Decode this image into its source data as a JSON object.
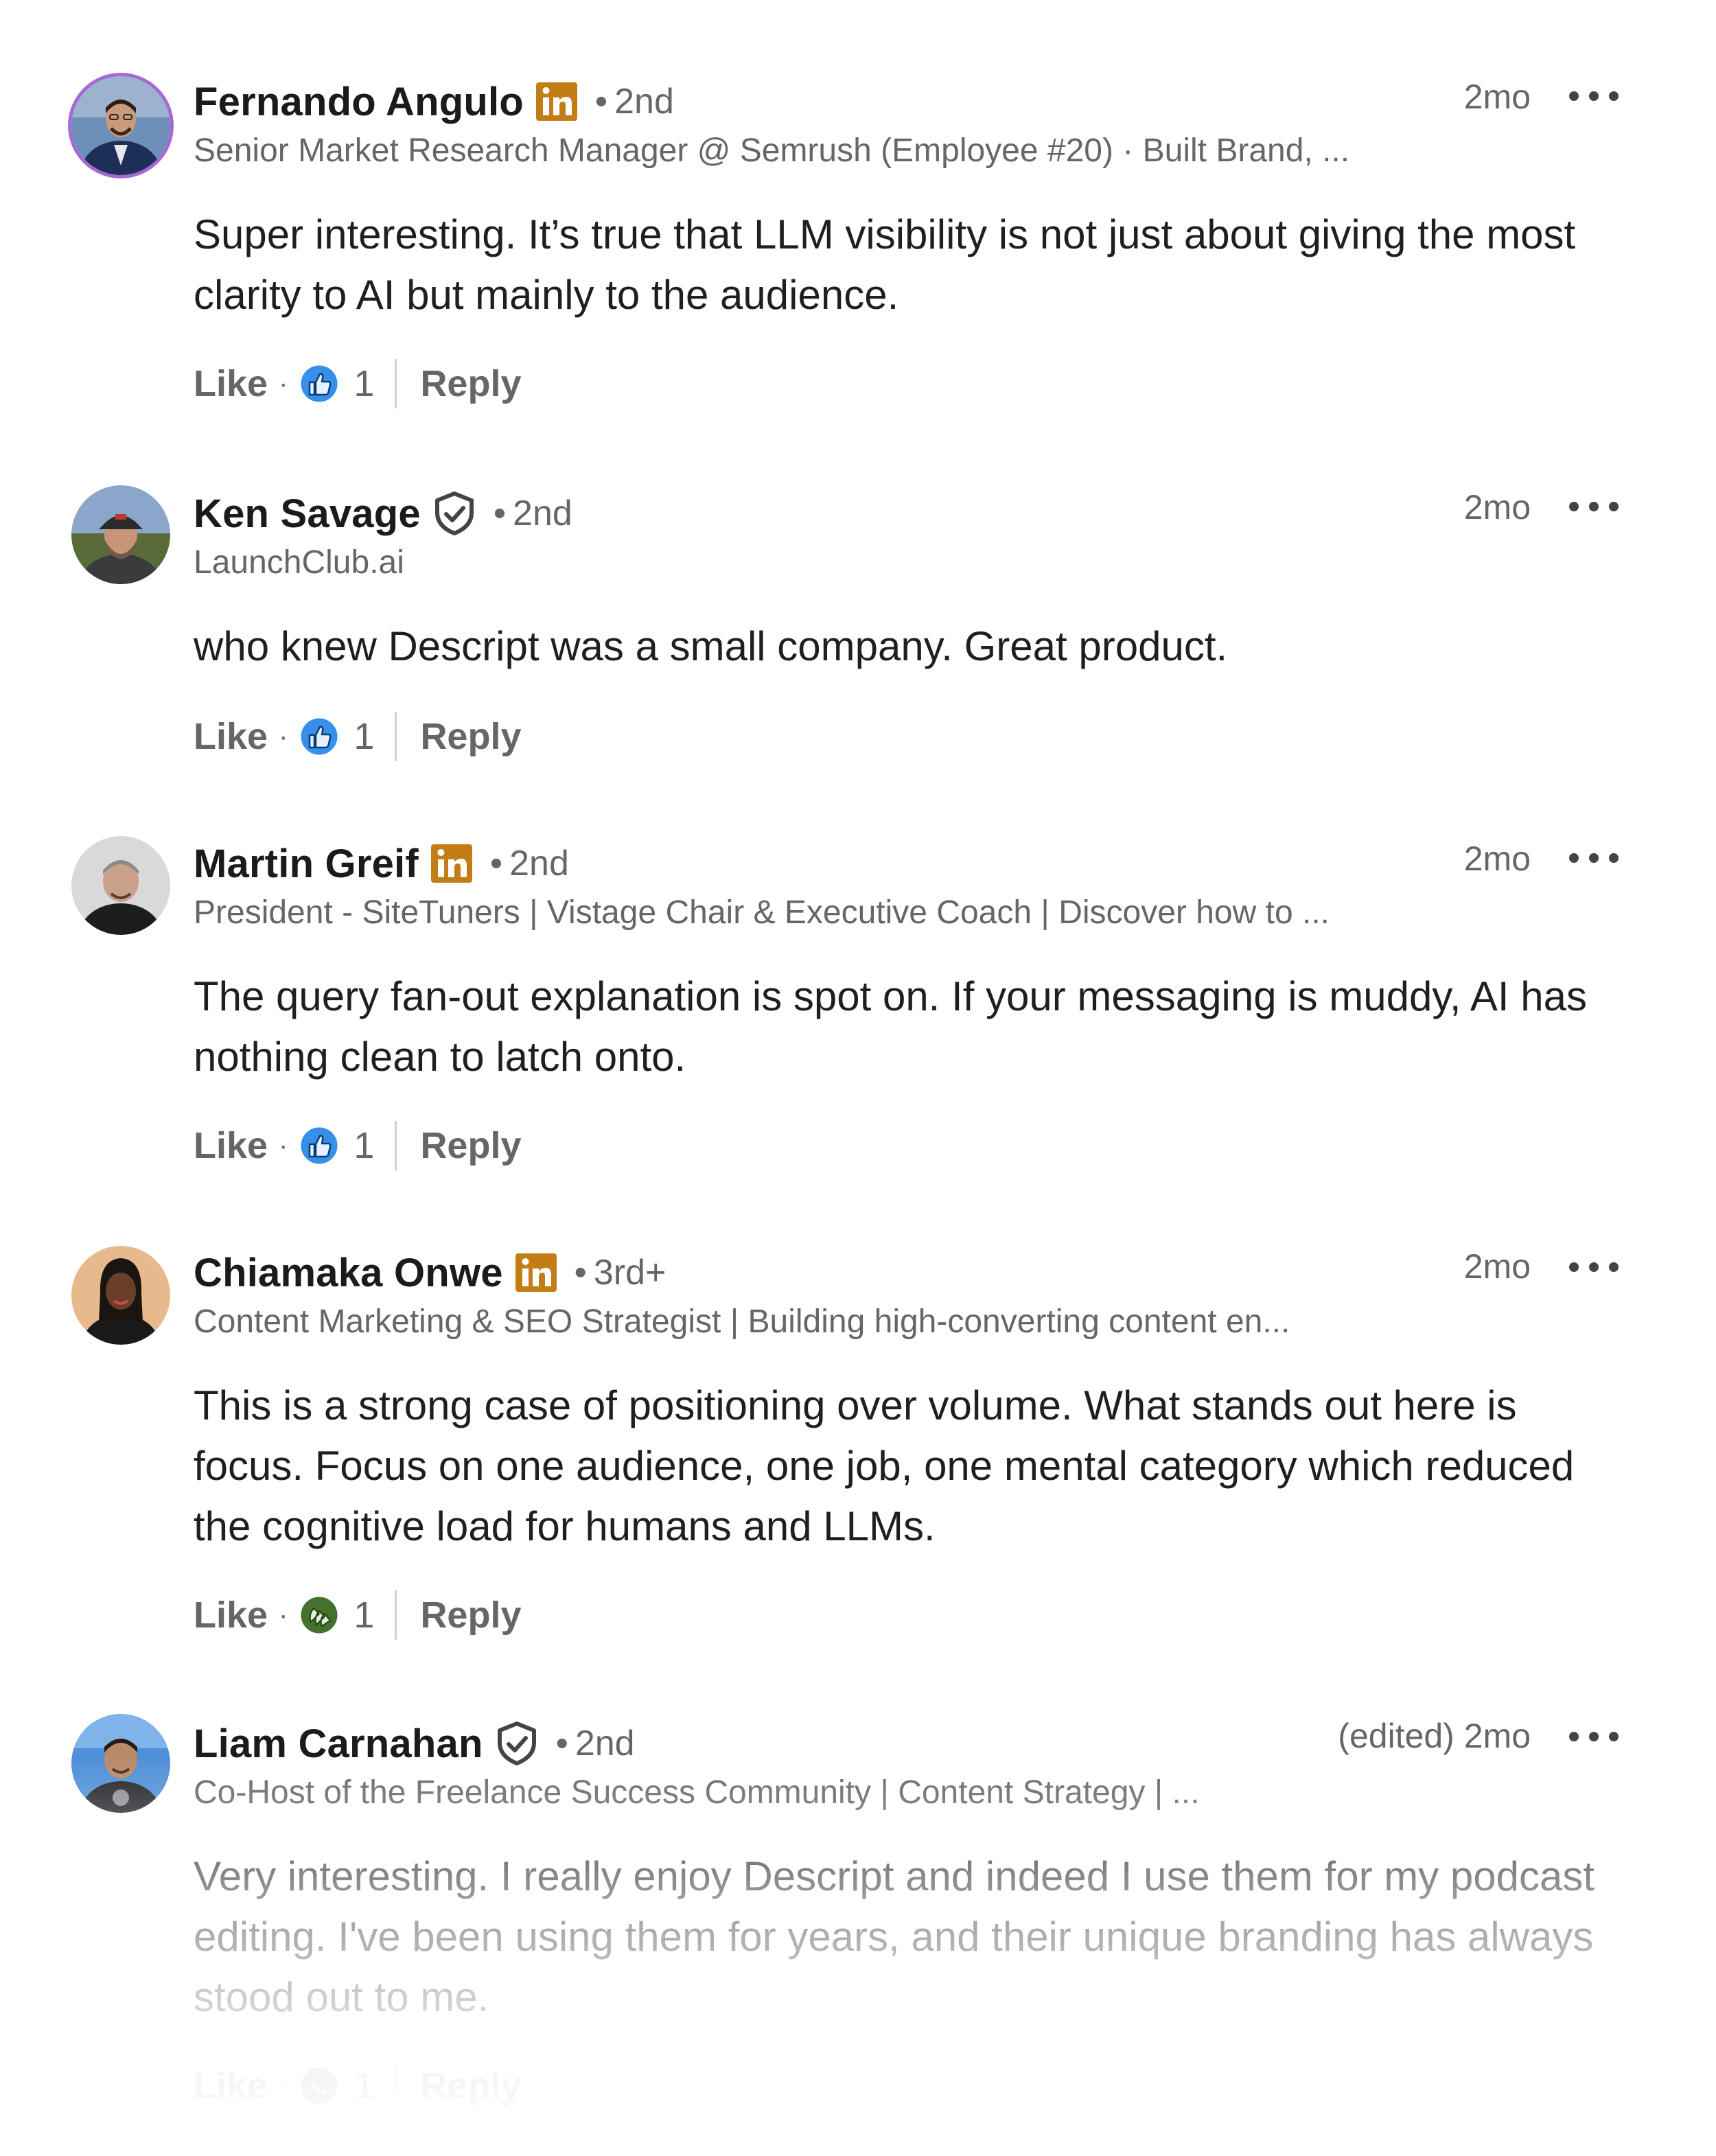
{
  "comments": [
    {
      "name": "Fernando Angulo",
      "badge": "linkedin-premium-icon",
      "degree": "2nd",
      "headline": "Senior Market Research Manager @ Semrush (Employee #20) · Built Brand, ...",
      "time": "2mo",
      "edited": "",
      "lines": [
        "Super interesting. It’s true that LLM visibility is not just about giving the most",
        "clarity to AI but mainly to the audience."
      ],
      "like_label": "Like",
      "reaction": "like-reaction-icon",
      "count": "1",
      "reply_label": "Reply"
    },
    {
      "name": "Ken Savage",
      "badge": "verified-shield-icon",
      "degree": "2nd",
      "headline": "LaunchClub.ai",
      "time": "2mo",
      "edited": "",
      "lines": [
        "who knew Descript was a small company. Great product."
      ],
      "like_label": "Like",
      "reaction": "like-reaction-icon",
      "count": "1",
      "reply_label": "Reply"
    },
    {
      "name": "Martin Greif",
      "badge": "linkedin-premium-icon",
      "degree": "2nd",
      "headline": "President - SiteTuners | Vistage Chair & Executive Coach | Discover how to ...",
      "time": "2mo",
      "edited": "",
      "lines": [
        "The query fan-out explanation is spot on. If your messaging is muddy, AI has",
        "nothing clean to latch onto."
      ],
      "like_label": "Like",
      "reaction": "like-reaction-icon",
      "count": "1",
      "reply_label": "Reply"
    },
    {
      "name": "Chiamaka Onwe",
      "badge": "linkedin-premium-icon",
      "degree": "3rd+",
      "headline": "Content Marketing & SEO Strategist | Building high-converting content en...",
      "time": "2mo",
      "edited": "",
      "lines": [
        "This is a strong case of positioning over volume. What stands out here is",
        "focus. Focus on one audience, one job, one mental category which reduced",
        "the cognitive load for humans and LLMs."
      ],
      "like_label": "Like",
      "reaction": "celebrate-reaction-icon",
      "count": "1",
      "reply_label": "Reply"
    },
    {
      "name": "Liam Carnahan",
      "badge": "verified-shield-icon",
      "degree": "2nd",
      "headline": "Co-Host of the Freelance Success Community | Content Strategy | ...",
      "time": "2mo",
      "edited": "(edited)",
      "lines": [
        "Very interesting. I really enjoy Descript and indeed I use them for my podcast",
        "editing. I've been using them for years, and their unique branding has always",
        "stood out to me."
      ],
      "like_label": "Like",
      "reaction": "celebrate-reaction-icon",
      "count": "1",
      "reply_label": "Reply"
    }
  ],
  "colors": {
    "premium_gold": "#c37d16",
    "like_blue": "#378fe9",
    "celebrate_green": "#44712e",
    "avatar_ring": "#a768d6",
    "secondary_text": "#666666"
  }
}
